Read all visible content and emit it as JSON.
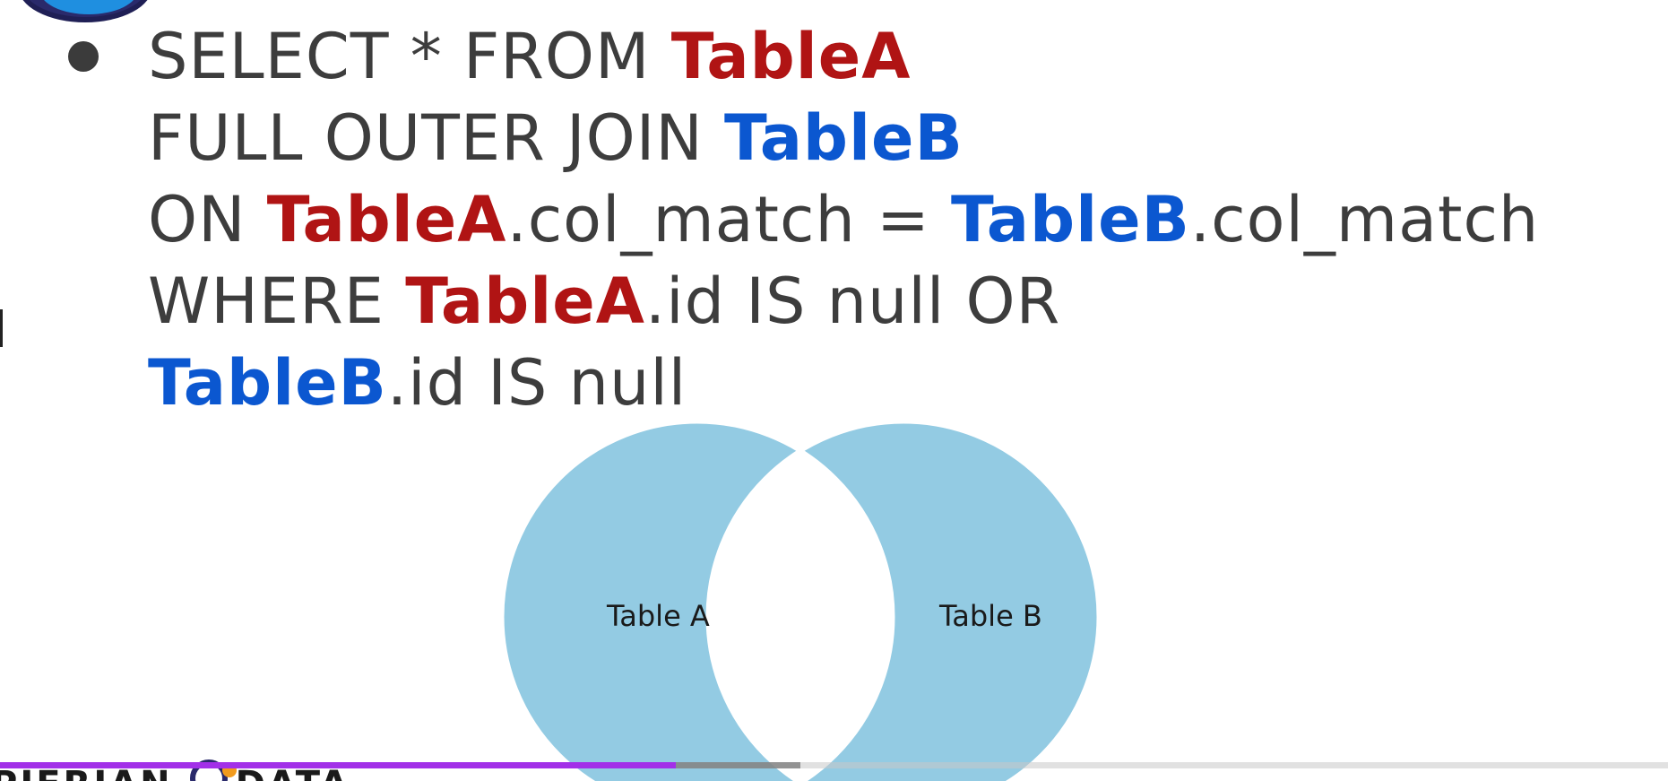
{
  "slide": {
    "query_lines": [
      [
        {
          "text": "SELECT * FROM ",
          "style": "plain"
        },
        {
          "text": "TableA",
          "style": "a"
        }
      ],
      [
        {
          "text": "FULL OUTER JOIN ",
          "style": "plain"
        },
        {
          "text": "TableB",
          "style": "b"
        }
      ],
      [
        {
          "text": "ON ",
          "style": "plain"
        },
        {
          "text": "TableA",
          "style": "a"
        },
        {
          "text": ".col_match = ",
          "style": "plain"
        },
        {
          "text": "TableB",
          "style": "b"
        },
        {
          "text": ".col_match",
          "style": "plain"
        }
      ],
      [
        {
          "text": "WHERE ",
          "style": "plain"
        },
        {
          "text": "TableA",
          "style": "a"
        },
        {
          "text": ".id IS null OR",
          "style": "plain"
        }
      ],
      [
        {
          "text": "TableB",
          "style": "b"
        },
        {
          "text": ".id IS null",
          "style": "plain"
        }
      ]
    ],
    "colors": {
      "text": "#3d3d3d",
      "table_a": "#b01414",
      "table_b": "#0b57d0",
      "venn_fill": "#93cbe3"
    }
  },
  "venn": {
    "left_label": "Table A",
    "right_label": "Table B"
  },
  "footer": {
    "brand_left": "PIERIAN",
    "brand_right": "DATA"
  },
  "player": {
    "played_fraction": 0.405,
    "buffered_fraction": 0.48,
    "played_color": "#a230e8"
  }
}
